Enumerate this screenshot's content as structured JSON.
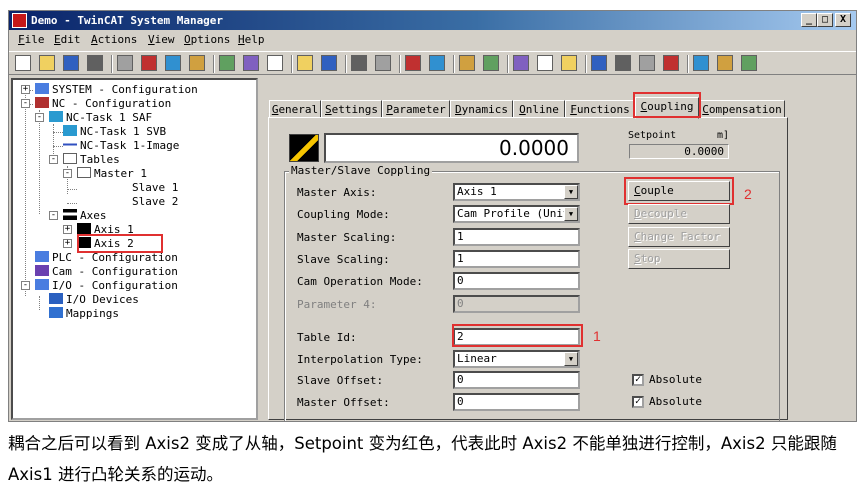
{
  "window": {
    "title": "Demo - TwinCAT System Manager",
    "controls": [
      "_",
      "□",
      "X"
    ]
  },
  "menu": [
    "File",
    "Edit",
    "Actions",
    "View",
    "Options",
    "Help"
  ],
  "toolbar": {
    "icons": [
      "new-icon",
      "open-icon",
      "save-icon",
      "print-icon",
      "print-preview-icon",
      "cut-icon",
      "copy-icon",
      "paste-icon",
      "paste-link-icon",
      "find-icon",
      "find-next-icon",
      "monitor-icon",
      "activate-config-icon",
      "check-config-icon",
      "build-icon",
      "run-mode-icon",
      "config-mode-icon",
      "scan-icon",
      "network-icon",
      "target-icon",
      "toggle-icon",
      "show-vars-icon",
      "zoom-icon",
      "link-icon",
      "var-watch-icon",
      "io-icon",
      "book-icon",
      "help-icon",
      "about-icon"
    ]
  },
  "tree": {
    "system": "SYSTEM - Configuration",
    "nc": "NC - Configuration",
    "task": "NC-Task 1 SAF",
    "svb": "NC-Task 1 SVB",
    "image": "NC-Task 1-Image",
    "tables": "Tables",
    "master1": "Master 1",
    "slave1": "Slave 1",
    "slave2": "Slave 2",
    "axes": "Axes",
    "axis1": "Axis 1",
    "axis2": "Axis 2",
    "plc": "PLC - Configuration",
    "cam": "Cam - Configuration",
    "io": "I/O - Configuration",
    "io_devices": "I/O Devices",
    "mappings": "Mappings"
  },
  "tabs": [
    "General",
    "Settings",
    "Parameter",
    "Dynamics",
    "Online",
    "Functions",
    "Coupling",
    "Compensation"
  ],
  "active_tab": "Coupling",
  "online": {
    "actual_position": "0.0000",
    "setpoint_label": "Setpoint",
    "setpoint_unit": "m]",
    "setpoint_value": "0.0000"
  },
  "group_title": "Master/Slave Coppling",
  "fields": {
    "master_axis": {
      "label": "Master Axis:",
      "value": "Axis 1"
    },
    "coupling_mode": {
      "label": "Coupling Mode:",
      "value": "Cam Profile (Univ"
    },
    "master_scaling": {
      "label": "Master Scaling:",
      "value": "1"
    },
    "slave_scaling": {
      "label": "Slave Scaling:",
      "value": "1"
    },
    "cam_operation_mode": {
      "label": "Cam Operation Mode:",
      "value": "0"
    },
    "parameter4": {
      "label": "Parameter 4:",
      "value": "0"
    },
    "table_id": {
      "label": "Table Id:",
      "value": "2"
    },
    "interpolation_type": {
      "label": "Interpolation Type:",
      "value": "Linear"
    },
    "slave_offset": {
      "label": "Slave Offset:",
      "value": "0"
    },
    "master_offset": {
      "label": "Master Offset:",
      "value": "0"
    }
  },
  "buttons": {
    "couple": "Couple",
    "decouple": "Decouple",
    "change_factor": "Change Factor",
    "stop": "Stop"
  },
  "checkboxes": {
    "slave_absolute": {
      "label": "Absolute",
      "checked": true
    },
    "master_absolute": {
      "label": "Absolute",
      "checked": true
    }
  },
  "callouts": {
    "one": "1",
    "two": "2"
  },
  "caption": "耦合之后可以看到 Axis2 变成了从轴，Setpoint 变为红色，代表此时 Axis2 不能单独进行控制，Axis2 只能跟随 Axis1 进行凸轮关系的运动。",
  "colors": {
    "highlight": "#e03030",
    "titlebar": "#0a246a",
    "face": "#d4d0c8"
  }
}
